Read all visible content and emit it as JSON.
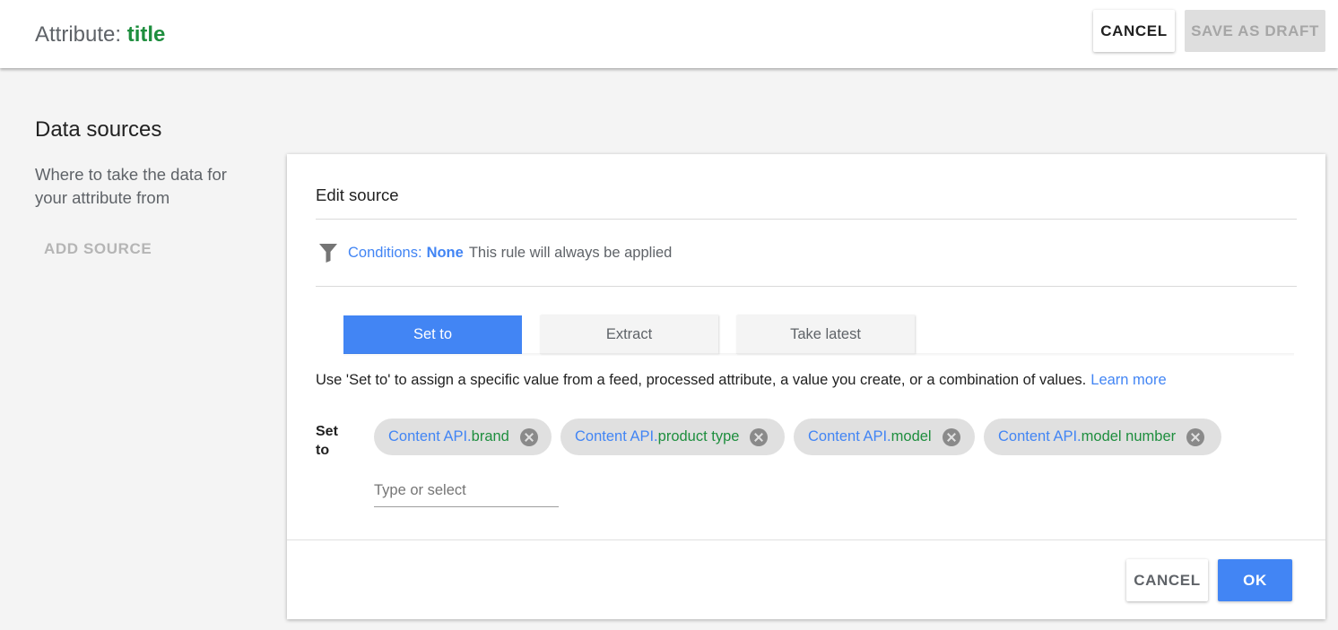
{
  "header": {
    "title_prefix": "Attribute: ",
    "attribute_name": "title",
    "cancel_label": "CANCEL",
    "save_draft_label": "SAVE AS DRAFT"
  },
  "sidebar": {
    "heading": "Data sources",
    "description": "Where to take the data for your attribute from",
    "add_source_label": "ADD SOURCE"
  },
  "card": {
    "title": "Edit source",
    "conditions": {
      "icon": "filter-icon",
      "label": "Conditions:",
      "value": "None",
      "description": "This rule will always be applied"
    },
    "tabs": [
      {
        "label": "Set to",
        "active": true
      },
      {
        "label": "Extract",
        "active": false
      },
      {
        "label": "Take latest",
        "active": false
      }
    ],
    "help_text": "Use 'Set to' to assign a specific value from a feed, processed attribute, a value you create, or a combination of values.",
    "learn_more": "Learn more",
    "set_to_label": "Set to",
    "chips": [
      {
        "source": "Content API.",
        "field": "brand"
      },
      {
        "source": "Content API.",
        "field": "product type"
      },
      {
        "source": "Content API.",
        "field": "model"
      },
      {
        "source": "Content API.",
        "field": "model number"
      }
    ],
    "input_placeholder": "Type or select",
    "cancel_label": "CANCEL",
    "ok_label": "OK"
  },
  "colors": {
    "accent": "#4285f4",
    "attribute_green": "#1e8e3e",
    "disabled_bg": "#dedede"
  }
}
